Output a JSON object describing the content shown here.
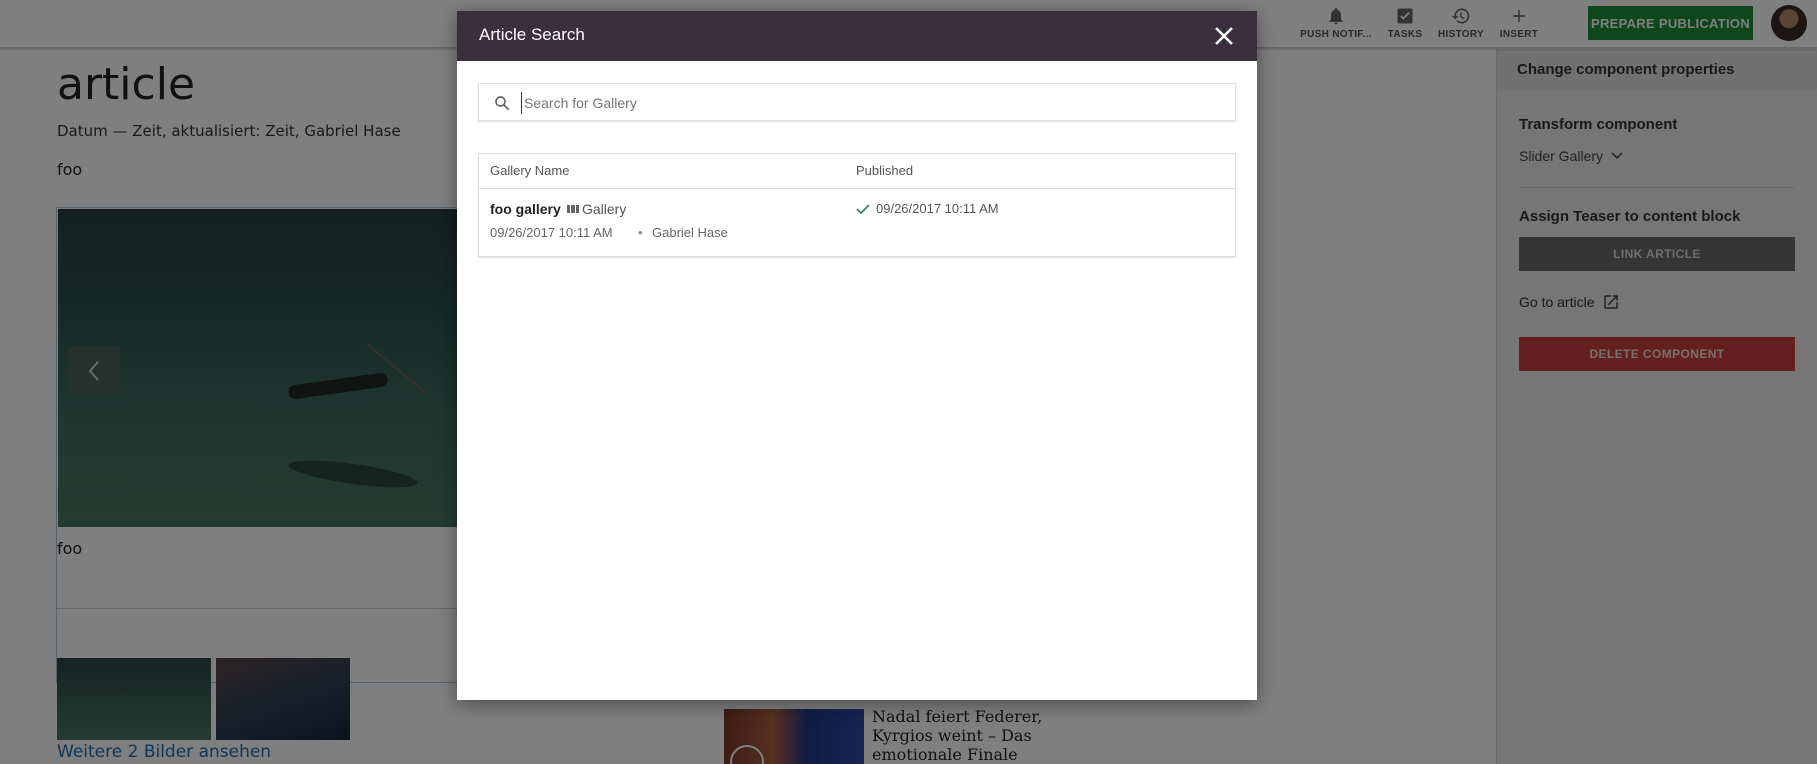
{
  "topbar": {
    "buttons": [
      {
        "label": "PUSH NOTIF...",
        "icon": "bell-icon"
      },
      {
        "label": "TASKS",
        "icon": "tasks-icon"
      },
      {
        "label": "HISTORY",
        "icon": "history-icon"
      },
      {
        "label": "INSERT",
        "icon": "plus-icon"
      }
    ],
    "prepare_label": "PREPARE PUBLICATION"
  },
  "article": {
    "title": "article",
    "meta": "Datum — Zeit, aktualisiert: Zeit, Gabriel Hase",
    "text1": "foo",
    "gallery_caption": "foo",
    "more_link": "Weitere 2 Bilder ansehen",
    "teaser_text": "Nadal feiert Federer, Kyrgios weint – Das emotionale Finale beim"
  },
  "panel": {
    "header": "Change component properties",
    "transform_heading": "Transform component",
    "transform_value": "Slider Gallery",
    "assign_heading": "Assign Teaser to content block",
    "link_button": "LINK ARTICLE",
    "goto_label": "Go to article",
    "delete_button": "DELETE COMPONENT"
  },
  "modal": {
    "title": "Article Search",
    "search": {
      "placeholder": "Search for Gallery",
      "value": ""
    },
    "columns": [
      "Gallery Name",
      "Published"
    ],
    "rows": [
      {
        "name": "foo gallery",
        "type": "Gallery",
        "created": "09/26/2017 10:11 AM",
        "author": "Gabriel Hase",
        "published": "09/26/2017 10:11 AM"
      }
    ]
  },
  "colors": {
    "modal_header": "#3a2e3f",
    "prepare_button": "#1f8f3a",
    "delete_button": "#c9403e",
    "link_button": "#6a6a6a",
    "link_text": "#1a6eb5"
  }
}
